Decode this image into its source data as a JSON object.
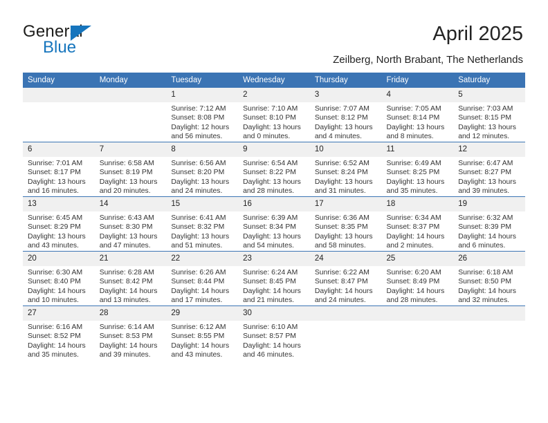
{
  "brand": {
    "name_top": "General",
    "name_bottom": "Blue",
    "accent_color": "#1675bd"
  },
  "header": {
    "title": "April 2025",
    "subtitle": "Zeilberg, North Brabant, The Netherlands",
    "header_bg": "#3b74b4"
  },
  "weekdays": [
    "Sunday",
    "Monday",
    "Tuesday",
    "Wednesday",
    "Thursday",
    "Friday",
    "Saturday"
  ],
  "labels": {
    "sunrise": "Sunrise:",
    "sunset": "Sunset:",
    "daylight": "Daylight:"
  },
  "weeks": [
    [
      {
        "day": "",
        "blank": true
      },
      {
        "day": "",
        "blank": true
      },
      {
        "day": "1",
        "sunrise": "Sunrise: 7:12 AM",
        "sunset": "Sunset: 8:08 PM",
        "daylight_1": "Daylight: 12 hours",
        "daylight_2": "and 56 minutes."
      },
      {
        "day": "2",
        "sunrise": "Sunrise: 7:10 AM",
        "sunset": "Sunset: 8:10 PM",
        "daylight_1": "Daylight: 13 hours",
        "daylight_2": "and 0 minutes."
      },
      {
        "day": "3",
        "sunrise": "Sunrise: 7:07 AM",
        "sunset": "Sunset: 8:12 PM",
        "daylight_1": "Daylight: 13 hours",
        "daylight_2": "and 4 minutes."
      },
      {
        "day": "4",
        "sunrise": "Sunrise: 7:05 AM",
        "sunset": "Sunset: 8:14 PM",
        "daylight_1": "Daylight: 13 hours",
        "daylight_2": "and 8 minutes."
      },
      {
        "day": "5",
        "sunrise": "Sunrise: 7:03 AM",
        "sunset": "Sunset: 8:15 PM",
        "daylight_1": "Daylight: 13 hours",
        "daylight_2": "and 12 minutes."
      }
    ],
    [
      {
        "day": "6",
        "sunrise": "Sunrise: 7:01 AM",
        "sunset": "Sunset: 8:17 PM",
        "daylight_1": "Daylight: 13 hours",
        "daylight_2": "and 16 minutes."
      },
      {
        "day": "7",
        "sunrise": "Sunrise: 6:58 AM",
        "sunset": "Sunset: 8:19 PM",
        "daylight_1": "Daylight: 13 hours",
        "daylight_2": "and 20 minutes."
      },
      {
        "day": "8",
        "sunrise": "Sunrise: 6:56 AM",
        "sunset": "Sunset: 8:20 PM",
        "daylight_1": "Daylight: 13 hours",
        "daylight_2": "and 24 minutes."
      },
      {
        "day": "9",
        "sunrise": "Sunrise: 6:54 AM",
        "sunset": "Sunset: 8:22 PM",
        "daylight_1": "Daylight: 13 hours",
        "daylight_2": "and 28 minutes."
      },
      {
        "day": "10",
        "sunrise": "Sunrise: 6:52 AM",
        "sunset": "Sunset: 8:24 PM",
        "daylight_1": "Daylight: 13 hours",
        "daylight_2": "and 31 minutes."
      },
      {
        "day": "11",
        "sunrise": "Sunrise: 6:49 AM",
        "sunset": "Sunset: 8:25 PM",
        "daylight_1": "Daylight: 13 hours",
        "daylight_2": "and 35 minutes."
      },
      {
        "day": "12",
        "sunrise": "Sunrise: 6:47 AM",
        "sunset": "Sunset: 8:27 PM",
        "daylight_1": "Daylight: 13 hours",
        "daylight_2": "and 39 minutes."
      }
    ],
    [
      {
        "day": "13",
        "sunrise": "Sunrise: 6:45 AM",
        "sunset": "Sunset: 8:29 PM",
        "daylight_1": "Daylight: 13 hours",
        "daylight_2": "and 43 minutes."
      },
      {
        "day": "14",
        "sunrise": "Sunrise: 6:43 AM",
        "sunset": "Sunset: 8:30 PM",
        "daylight_1": "Daylight: 13 hours",
        "daylight_2": "and 47 minutes."
      },
      {
        "day": "15",
        "sunrise": "Sunrise: 6:41 AM",
        "sunset": "Sunset: 8:32 PM",
        "daylight_1": "Daylight: 13 hours",
        "daylight_2": "and 51 minutes."
      },
      {
        "day": "16",
        "sunrise": "Sunrise: 6:39 AM",
        "sunset": "Sunset: 8:34 PM",
        "daylight_1": "Daylight: 13 hours",
        "daylight_2": "and 54 minutes."
      },
      {
        "day": "17",
        "sunrise": "Sunrise: 6:36 AM",
        "sunset": "Sunset: 8:35 PM",
        "daylight_1": "Daylight: 13 hours",
        "daylight_2": "and 58 minutes."
      },
      {
        "day": "18",
        "sunrise": "Sunrise: 6:34 AM",
        "sunset": "Sunset: 8:37 PM",
        "daylight_1": "Daylight: 14 hours",
        "daylight_2": "and 2 minutes."
      },
      {
        "day": "19",
        "sunrise": "Sunrise: 6:32 AM",
        "sunset": "Sunset: 8:39 PM",
        "daylight_1": "Daylight: 14 hours",
        "daylight_2": "and 6 minutes."
      }
    ],
    [
      {
        "day": "20",
        "sunrise": "Sunrise: 6:30 AM",
        "sunset": "Sunset: 8:40 PM",
        "daylight_1": "Daylight: 14 hours",
        "daylight_2": "and 10 minutes."
      },
      {
        "day": "21",
        "sunrise": "Sunrise: 6:28 AM",
        "sunset": "Sunset: 8:42 PM",
        "daylight_1": "Daylight: 14 hours",
        "daylight_2": "and 13 minutes."
      },
      {
        "day": "22",
        "sunrise": "Sunrise: 6:26 AM",
        "sunset": "Sunset: 8:44 PM",
        "daylight_1": "Daylight: 14 hours",
        "daylight_2": "and 17 minutes."
      },
      {
        "day": "23",
        "sunrise": "Sunrise: 6:24 AM",
        "sunset": "Sunset: 8:45 PM",
        "daylight_1": "Daylight: 14 hours",
        "daylight_2": "and 21 minutes."
      },
      {
        "day": "24",
        "sunrise": "Sunrise: 6:22 AM",
        "sunset": "Sunset: 8:47 PM",
        "daylight_1": "Daylight: 14 hours",
        "daylight_2": "and 24 minutes."
      },
      {
        "day": "25",
        "sunrise": "Sunrise: 6:20 AM",
        "sunset": "Sunset: 8:49 PM",
        "daylight_1": "Daylight: 14 hours",
        "daylight_2": "and 28 minutes."
      },
      {
        "day": "26",
        "sunrise": "Sunrise: 6:18 AM",
        "sunset": "Sunset: 8:50 PM",
        "daylight_1": "Daylight: 14 hours",
        "daylight_2": "and 32 minutes."
      }
    ],
    [
      {
        "day": "27",
        "sunrise": "Sunrise: 6:16 AM",
        "sunset": "Sunset: 8:52 PM",
        "daylight_1": "Daylight: 14 hours",
        "daylight_2": "and 35 minutes."
      },
      {
        "day": "28",
        "sunrise": "Sunrise: 6:14 AM",
        "sunset": "Sunset: 8:53 PM",
        "daylight_1": "Daylight: 14 hours",
        "daylight_2": "and 39 minutes."
      },
      {
        "day": "29",
        "sunrise": "Sunrise: 6:12 AM",
        "sunset": "Sunset: 8:55 PM",
        "daylight_1": "Daylight: 14 hours",
        "daylight_2": "and 43 minutes."
      },
      {
        "day": "30",
        "sunrise": "Sunrise: 6:10 AM",
        "sunset": "Sunset: 8:57 PM",
        "daylight_1": "Daylight: 14 hours",
        "daylight_2": "and 46 minutes."
      },
      {
        "day": "",
        "blank": true
      },
      {
        "day": "",
        "blank": true
      },
      {
        "day": "",
        "blank": true
      }
    ]
  ]
}
